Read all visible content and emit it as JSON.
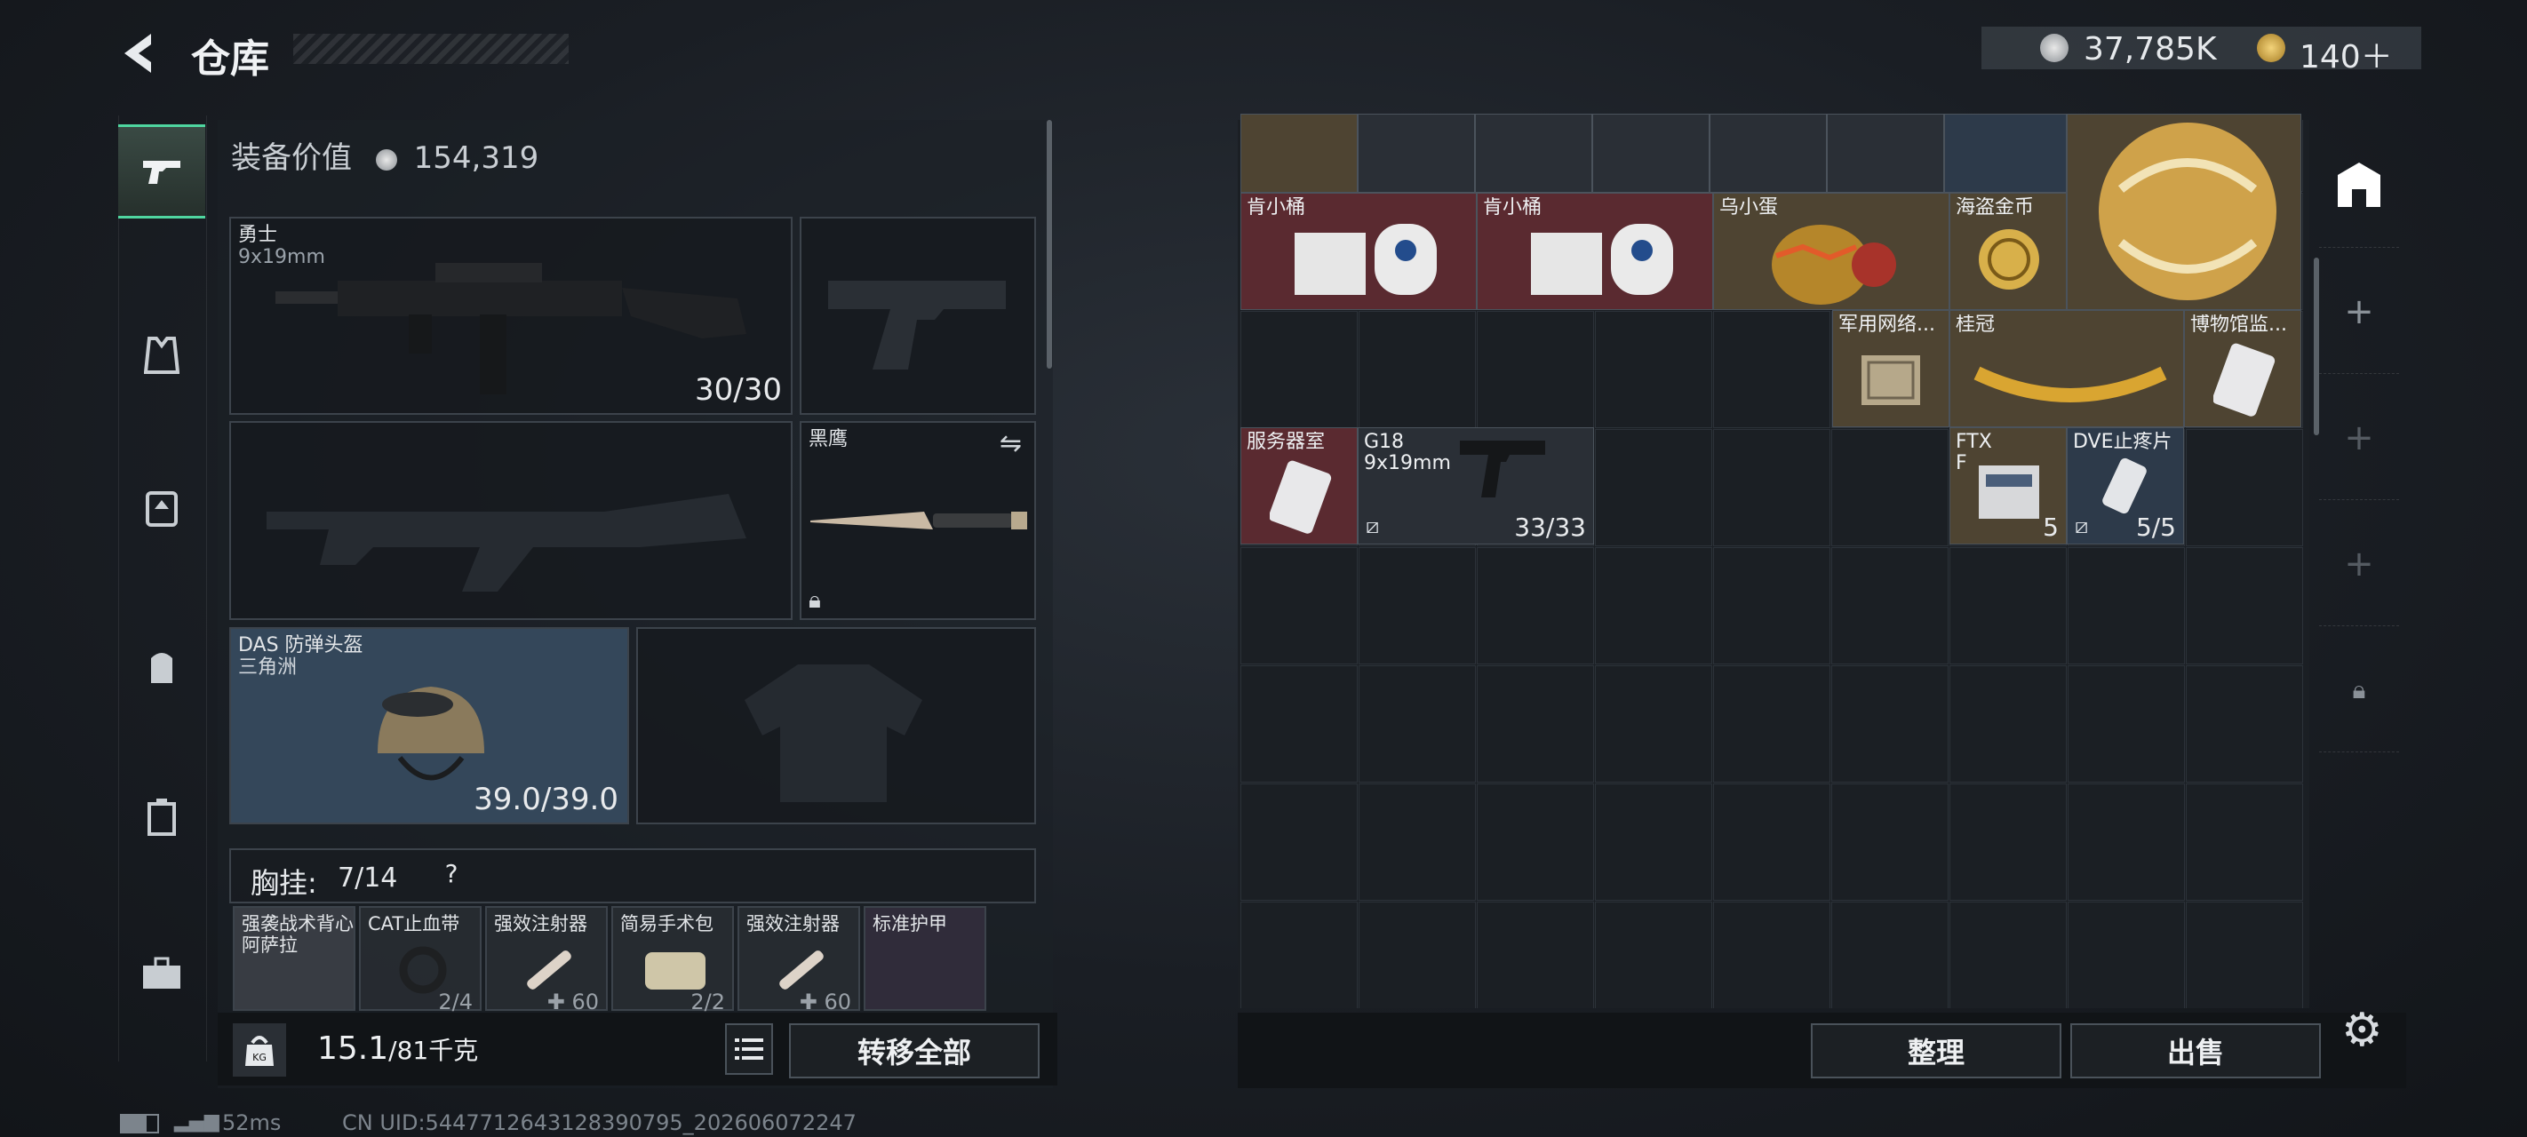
{
  "header": {
    "title": "仓库",
    "currency_primary": "37,785K",
    "currency_secondary": "140＋"
  },
  "loadout": {
    "value_label": "装备价值",
    "value": "154,319",
    "primary_weapon": {
      "name": "勇士",
      "caliber": "9x19mm",
      "ammo": "30/30"
    },
    "melee": {
      "name": "黑鹰"
    },
    "helmet": {
      "name": "DAS 防弹头盔",
      "sub": "三角洲",
      "durability": "39.0/39.0"
    },
    "chest_rig": {
      "label": "胸挂:",
      "capacity": "7/14",
      "help": "?"
    },
    "chest_items": [
      {
        "name": "强袭战术背心",
        "sub": "阿萨拉"
      },
      {
        "name": "CAT止血带",
        "count": "2/4"
      },
      {
        "name": "强效注射器",
        "count": "60"
      },
      {
        "name": "简易手术包",
        "count": "2/2"
      },
      {
        "name": "强效注射器",
        "count": "60"
      },
      {
        "name": "标准护甲"
      }
    ],
    "weight": "15.1",
    "weight_max": "/81千克",
    "weight_icon": "KG",
    "transfer_all": "转移全部"
  },
  "stash": {
    "items": [
      {
        "name": "肯小桶",
        "color": "red"
      },
      {
        "name": "肯小桶",
        "color": "red"
      },
      {
        "name": "乌小蛋",
        "color": "gold"
      },
      {
        "name": "海盗金币",
        "color": "gold"
      },
      {
        "name": "军用网络...",
        "color": "gold"
      },
      {
        "name": "桂冠",
        "color": "gold"
      },
      {
        "name": "博物馆监...",
        "color": "gold"
      },
      {
        "name": "服务器室",
        "color": "red"
      },
      {
        "name": "G18",
        "sub": "9x19mm",
        "count": "33/33",
        "color": "grey"
      },
      {
        "name": "FTX",
        "sub": "F",
        "count": "5",
        "color": "gold"
      },
      {
        "name": "DVE止疼片",
        "count": "5/5",
        "color": "blue"
      }
    ],
    "organize": "整理",
    "sell": "出售"
  },
  "status": {
    "ping": "52ms",
    "uid": "CN UID:5447712643128390795_202606072247"
  }
}
